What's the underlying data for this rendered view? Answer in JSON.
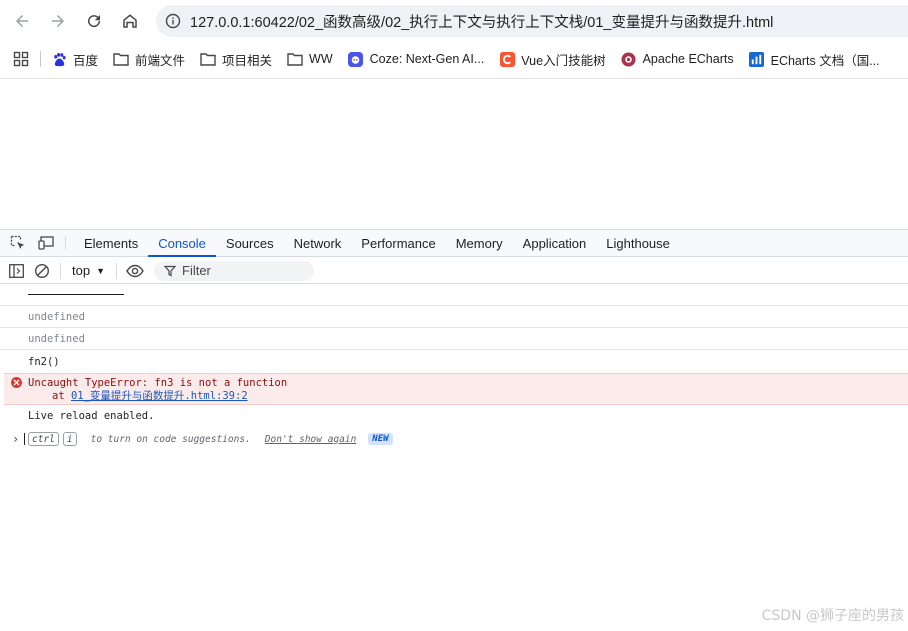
{
  "browser": {
    "url": "127.0.0.1:60422/02_函数高级/02_执行上下文与执行上下文栈/01_变量提升与函数提升.html"
  },
  "bookmarks": [
    {
      "label": "百度",
      "icon": "baidu-paw-icon",
      "color": "#2932e1"
    },
    {
      "label": "前端文件",
      "icon": "folder-icon"
    },
    {
      "label": "项目相关",
      "icon": "folder-icon"
    },
    {
      "label": "WW",
      "icon": "folder-icon"
    },
    {
      "label": "Coze: Next-Gen AI...",
      "icon": "coze-icon",
      "color": "#4d53e8"
    },
    {
      "label": "Vue入门技能树",
      "icon": "csdn-icon",
      "color": "#fc5531"
    },
    {
      "label": "Apache ECharts",
      "icon": "echarts-icon",
      "color": "#aa344d"
    },
    {
      "label": "ECharts 文档（国...",
      "icon": "chart-icon",
      "color": "#1967d2"
    }
  ],
  "devtools": {
    "tabs": [
      "Elements",
      "Console",
      "Sources",
      "Network",
      "Performance",
      "Memory",
      "Application",
      "Lighthouse"
    ],
    "active_tab": "Console",
    "context": "top",
    "filter_placeholder": "Filter"
  },
  "console": {
    "undefined_1": "undefined",
    "undefined_2": "undefined",
    "fn_call": "fn2()",
    "error": {
      "message": "Uncaught TypeError: fn3 is not a function",
      "at": "at ",
      "link": "01_变量提升与函数提升.html:39:2"
    },
    "live_reload": "Live reload enabled.",
    "prompt": {
      "key1": "ctrl",
      "key2": "i",
      "hint": "to turn on code suggestions.",
      "dont_show": "Don't show again",
      "badge": "NEW"
    }
  },
  "watermark": "CSDN @狮子座的男孩",
  "colors": {
    "accent": "#0b57d0",
    "error_bg": "#fcebeb",
    "error_text": "#8e0c0c"
  }
}
